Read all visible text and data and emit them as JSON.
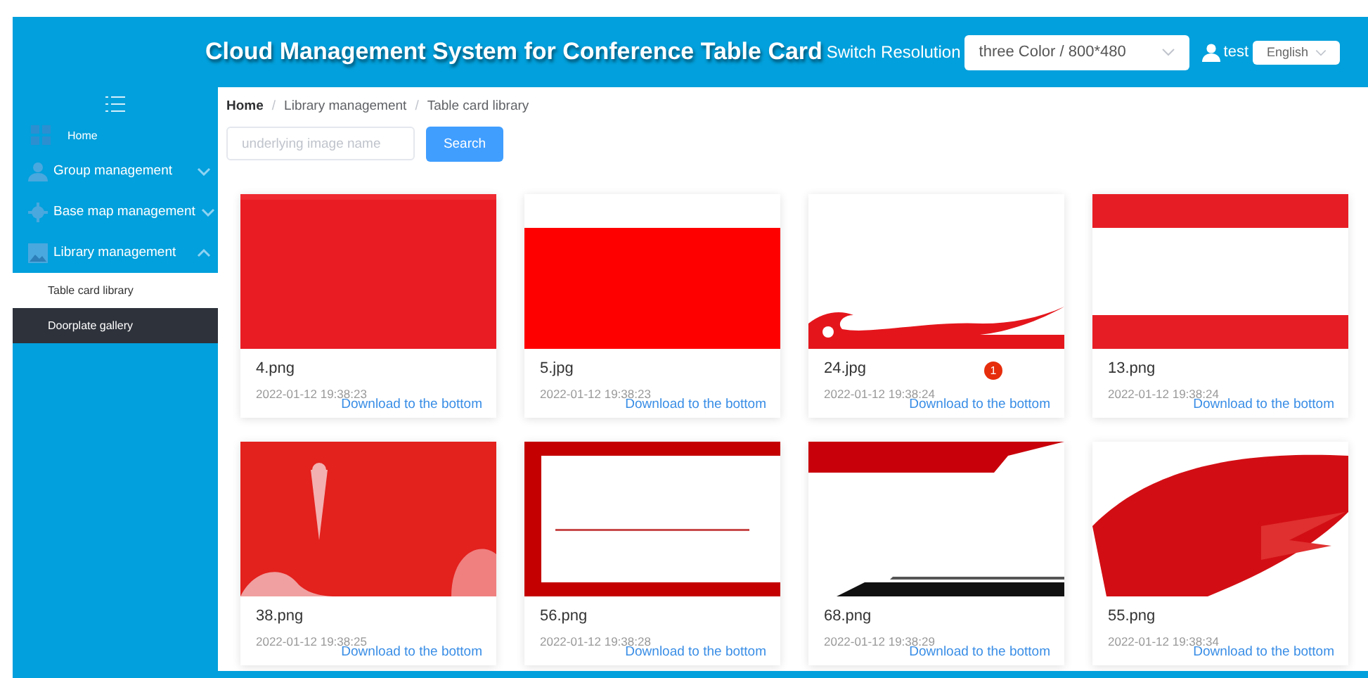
{
  "header": {
    "title": "Cloud Management System for Conference Table Card",
    "resolution_label": "Switch Resolution",
    "resolution_value": "three Color / 800*480",
    "user": "test",
    "language": "English"
  },
  "sidebar": {
    "items": [
      {
        "label": "Home"
      },
      {
        "label": "Group management",
        "expanded": false
      },
      {
        "label": "Base map management",
        "expanded": false
      },
      {
        "label": "Library management",
        "expanded": true,
        "children": [
          {
            "label": "Table card library",
            "selected": true
          },
          {
            "label": "Doorplate gallery",
            "selected": false
          }
        ]
      }
    ]
  },
  "breadcrumb": {
    "separator": "/",
    "items": [
      "Home",
      "Library management",
      "Table card library"
    ]
  },
  "search": {
    "placeholder": "underlying image name",
    "button": "Search"
  },
  "cards": [
    {
      "name": "4.png",
      "date": "2022-01-12 19:38:23",
      "link": "Download to the bottom"
    },
    {
      "name": "5.jpg",
      "date": "2022-01-12 19:38:23",
      "link": "Download to the bottom"
    },
    {
      "name": "24.jpg",
      "date": "2022-01-12 19:38:24",
      "link": "Download to the bottom",
      "badge": "1"
    },
    {
      "name": "13.png",
      "date": "2022-01-12 19:38:24",
      "link": "Download to the bottom"
    },
    {
      "name": "38.png",
      "date": "2022-01-12 19:38:25",
      "link": "Download to the bottom"
    },
    {
      "name": "56.png",
      "date": "2022-01-12 19:38:28",
      "link": "Download to the bottom"
    },
    {
      "name": "68.png",
      "date": "2022-01-12 19:38:29",
      "link": "Download to the bottom"
    },
    {
      "name": "55.png",
      "date": "2022-01-12 19:38:34",
      "link": "Download to the bottom"
    }
  ]
}
